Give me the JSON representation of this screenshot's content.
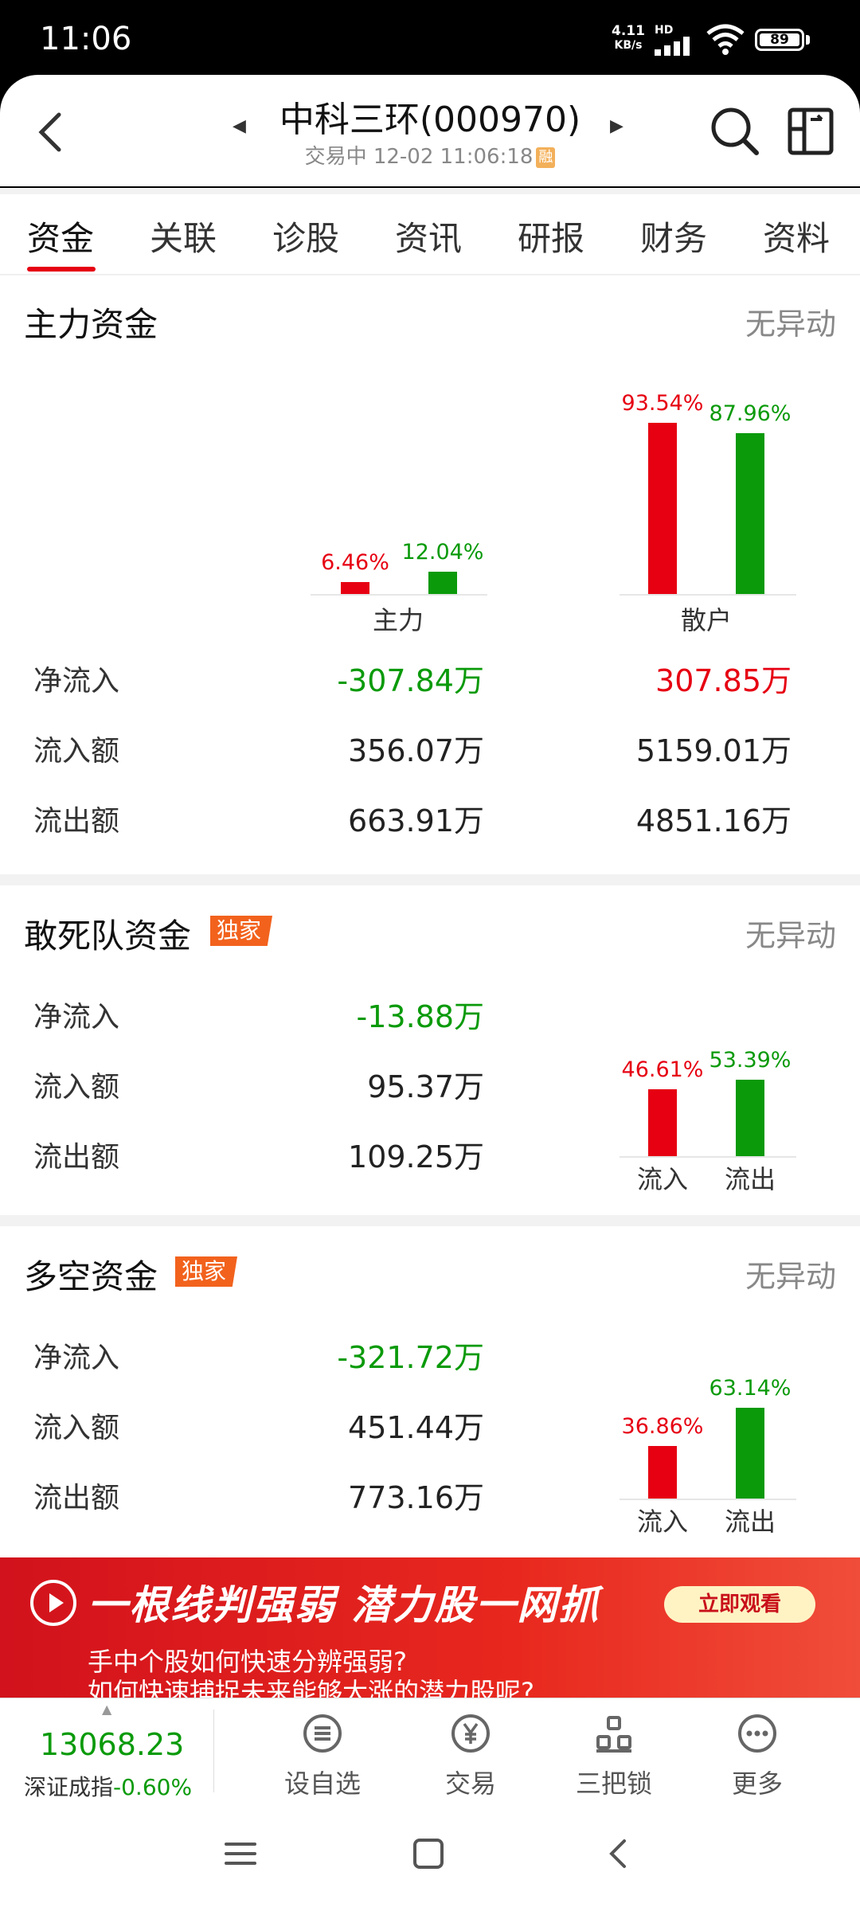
{
  "status_bar": {
    "time": "11:06",
    "net_speed": "4.11",
    "net_unit": "KB/s",
    "signal_tag": "HD",
    "battery": "89"
  },
  "header": {
    "title": "中科三环(000970)",
    "subtitle": "交易中 12-02 11:06:18",
    "rong_badge": "融"
  },
  "tabs": [
    "资金",
    "关联",
    "诊股",
    "资讯",
    "研报",
    "财务",
    "资料"
  ],
  "main_funds": {
    "title": "主力资金",
    "status": "无异动",
    "chart": {
      "groups": [
        {
          "label": "主力",
          "inflow_pct": "6.46%",
          "outflow_pct": "12.04%",
          "inflow": 6.46,
          "outflow": 12.04
        },
        {
          "label": "散户",
          "inflow_pct": "93.54%",
          "outflow_pct": "87.96%",
          "inflow": 93.54,
          "outflow": 87.96
        }
      ]
    },
    "rows": [
      {
        "label": "净流入",
        "main": "-307.84万",
        "retail": "307.85万"
      },
      {
        "label": "流入额",
        "main": "356.07万",
        "retail": "5159.01万"
      },
      {
        "label": "流出额",
        "main": "663.91万",
        "retail": "4851.16万"
      }
    ]
  },
  "dare_funds": {
    "title": "敢死队资金",
    "badge": "独家",
    "status": "无异动",
    "rows": [
      {
        "label": "净流入",
        "value": "-13.88万"
      },
      {
        "label": "流入额",
        "value": "95.37万"
      },
      {
        "label": "流出额",
        "value": "109.25万"
      }
    ],
    "chart": {
      "inflow_pct": "46.61%",
      "outflow_pct": "53.39%",
      "inflow": 46.61,
      "outflow": 53.39,
      "in_label": "流入",
      "out_label": "流出"
    }
  },
  "longshort_funds": {
    "title": "多空资金",
    "badge": "独家",
    "status": "无异动",
    "rows": [
      {
        "label": "净流入",
        "value": "-321.72万"
      },
      {
        "label": "流入额",
        "value": "451.44万"
      },
      {
        "label": "流出额",
        "value": "773.16万"
      }
    ],
    "chart": {
      "inflow_pct": "36.86%",
      "outflow_pct": "63.14%",
      "inflow": 36.86,
      "outflow": 63.14,
      "in_label": "流入",
      "out_label": "流出"
    }
  },
  "banner": {
    "headline": "一根线判强弱  潜力股一网抓",
    "cta": "立即观看",
    "line1": "手中个股如何快速分辨强弱?",
    "line2": "如何快速捕捉未来能够大涨的潜力股呢?"
  },
  "bottom_nav": {
    "index_value": "13068.23",
    "index_name": "深证成指",
    "index_change": "-0.60%",
    "items": [
      {
        "label": "设自选",
        "icon": "menu-list-icon"
      },
      {
        "label": "交易",
        "icon": "yuan-icon"
      },
      {
        "label": "三把锁",
        "icon": "lock-stack-icon"
      },
      {
        "label": "更多",
        "icon": "more-dots-icon"
      }
    ]
  },
  "colors": {
    "accent": "#e60012",
    "positive": "#e60012",
    "negative": "#0a9a0a",
    "badge": "#f2621d"
  }
}
